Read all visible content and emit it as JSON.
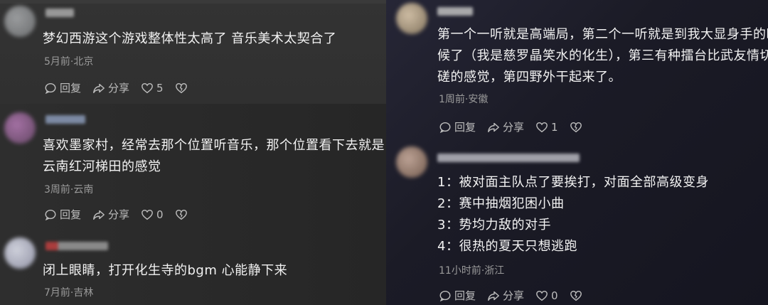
{
  "actions": {
    "reply": "回复",
    "share": "分享"
  },
  "left_comments": [
    {
      "text": "梦幻西游这个游戏整体性太高了   音乐美术太契合了",
      "meta": "5月前·北京",
      "likes": "5"
    },
    {
      "text_lines": [
        "喜欢墨家村，经常去那个位置听音乐，那个位置看下去就是",
        "云南红河梯田的感觉"
      ],
      "meta": "3周前·云南",
      "likes": "0"
    },
    {
      "text": "闭上眼睛，打开化生寺的bgm 心能静下来",
      "meta": "7月前·吉林"
    }
  ],
  "right_comments": [
    {
      "text_lines": [
        "第一个一听就是高端局，第二个一听就是到我大显身手的时",
        "候了（我是慈罗晶笑水的化生），第三有种擂台比武友情切",
        "磋的感觉，第四野外干起来了。"
      ],
      "meta": "1周前·安徽",
      "likes": "1"
    },
    {
      "text_lines": [
        "1：被对面主队点了要挨打，对面全部高级变身",
        "2：赛中抽烟犯困小曲",
        "3：势均力敌的对手",
        "4：很热的夏天只想逃跑"
      ],
      "meta": "11小时前·浙江",
      "likes": "0"
    }
  ],
  "colors": {
    "avatar_1": "#8c8e90",
    "avatar_2": "#9a6a9a",
    "avatar_3": "#c9cbd8",
    "avatar_4": "#c8b8a0",
    "avatar_5": "#a89080",
    "username_1": "#aaaaaa",
    "username_2": "#8a9ab8",
    "username_3": "#c04040",
    "username_4": "#c0c0c0",
    "username_5": "#b8b8c0"
  }
}
